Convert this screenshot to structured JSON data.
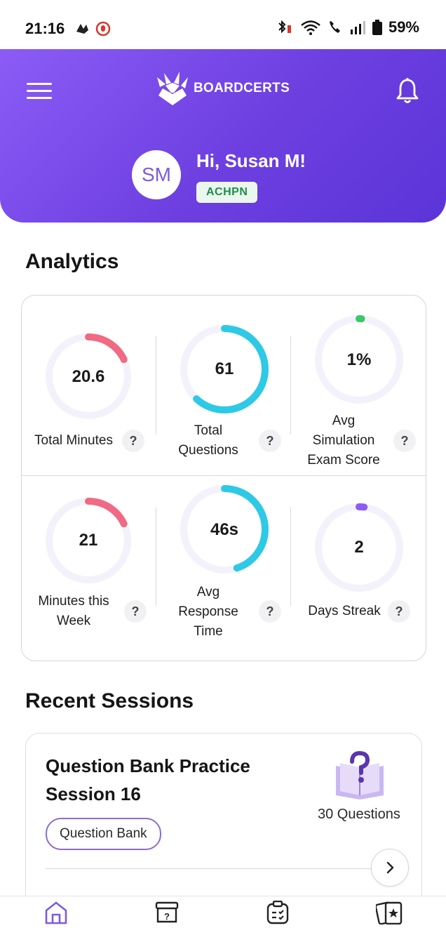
{
  "status_bar": {
    "time": "21:16",
    "battery": "59%"
  },
  "header": {
    "brand": "BOARDCERTS",
    "avatar_initials": "SM",
    "greeting": "Hi, Susan M!",
    "badge": "ACHPN",
    "colors": {
      "gradient_start": "#8b5cf6",
      "gradient_end": "#5b34d8",
      "badge_text": "#1e8e4a"
    }
  },
  "analytics": {
    "title": "Analytics",
    "metrics": [
      {
        "value": "20.6",
        "label": "Total Minutes",
        "progress": 0.18,
        "color": "#f06a84"
      },
      {
        "value": "61",
        "label": "Total Questions",
        "progress": 0.62,
        "color": "#2ec9e6"
      },
      {
        "value": "1%",
        "label": "Avg Simulation Exam Score",
        "progress": 0.01,
        "color": "#3cc76a"
      },
      {
        "value": "21",
        "label": "Minutes this Week",
        "progress": 0.18,
        "color": "#f06a84"
      },
      {
        "value": "46s",
        "label": "Avg Response Time",
        "progress": 0.45,
        "color": "#2ec9e6"
      },
      {
        "value": "2",
        "label": "Days Streak",
        "progress": 0.02,
        "color": "#8b5cf6"
      }
    ],
    "help_symbol": "?"
  },
  "recent_sessions": {
    "title": "Recent Sessions",
    "items": [
      {
        "title": "Question Bank Practice Session 16",
        "tag": "Question Bank",
        "count": "30 Questions",
        "icon": "question-book-icon"
      }
    ]
  },
  "bottom_nav": {
    "items": [
      {
        "icon": "home-icon",
        "active": true
      },
      {
        "icon": "question-box-icon",
        "active": false
      },
      {
        "icon": "clipboard-check-icon",
        "active": false
      },
      {
        "icon": "flashcards-star-icon",
        "active": false
      }
    ]
  }
}
